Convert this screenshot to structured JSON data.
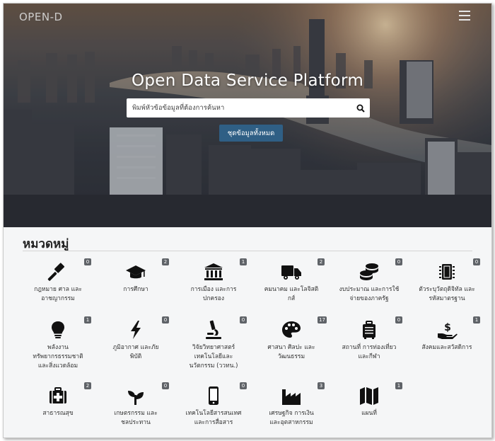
{
  "header": {
    "logo": {
      "main": "OPEN",
      "tail": "-D"
    },
    "menu_icon": "hamburger-icon"
  },
  "hero": {
    "title": "Open Data Service Platform",
    "search": {
      "placeholder": "พิมพ์หัวข้อข้อมูลที่ต้องการค้นหา",
      "value": "",
      "icon": "search-icon"
    },
    "all_datasets_label": "ชุดข้อมูลทั้งหมด",
    "accent": "#2f5f85"
  },
  "categories": {
    "title": "หมวดหมู่",
    "items": [
      {
        "label": "กฎหมาย ศาล และ\nอาชญากรรม",
        "count": "0",
        "icon": "gavel-icon"
      },
      {
        "label": "การศึกษา",
        "count": "2",
        "icon": "graduation-cap-icon"
      },
      {
        "label": "การเมือง และการ\nปกครอง",
        "count": "1",
        "icon": "government-building-icon"
      },
      {
        "label": "คมนาคม และโลจิสติ\nกส์",
        "count": "2",
        "icon": "truck-icon"
      },
      {
        "label": "งบประมาณ และการใช้\nจ่ายของภาครัฐ",
        "count": "0",
        "icon": "coins-icon"
      },
      {
        "label": "ตัวระบุวัตถุดิจิทัล และ\nรหัสมาตรฐาน",
        "count": "0",
        "icon": "microchip-icon"
      },
      {
        "label": "พลังงาน\nทรัพยากรธรรมชาติ\nและสิ่งแวดล้อม",
        "count": "1",
        "icon": "lightbulb-icon"
      },
      {
        "label": "ภูมิอากาศ และภัย\nพิบัติ",
        "count": "0",
        "icon": "lightning-icon"
      },
      {
        "label": "วิจัยวิทยาศาสตร์\nเทคโนโลยีและ\nนวัตกรรม (ววทน.)",
        "count": "0",
        "icon": "microscope-icon"
      },
      {
        "label": "ศาสนา ศิลปะ และ\nวัฒนธรรม",
        "count": "17",
        "icon": "palette-icon"
      },
      {
        "label": "สถานที่ การท่องเที่ยว\nและกีฬา",
        "count": "0",
        "icon": "suitcase-icon"
      },
      {
        "label": "สังคมและสวัสดิการ",
        "count": "1",
        "icon": "hand-dollar-icon"
      },
      {
        "label": "สาธารณสุข",
        "count": "2",
        "icon": "medical-kit-icon"
      },
      {
        "label": "เกษตรกรรม และ\nชลประทาน",
        "count": "0",
        "icon": "seedling-icon"
      },
      {
        "label": "เทคโนโลยีสารสนเทศ\nและการสื่อสาร",
        "count": "0",
        "icon": "mobile-phone-icon"
      },
      {
        "label": "เศรษฐกิจ การเงิน\nและอุตสาหกรรม",
        "count": "3",
        "icon": "factory-icon"
      },
      {
        "label": "แผนที่",
        "count": "1",
        "icon": "map-icon"
      }
    ]
  }
}
